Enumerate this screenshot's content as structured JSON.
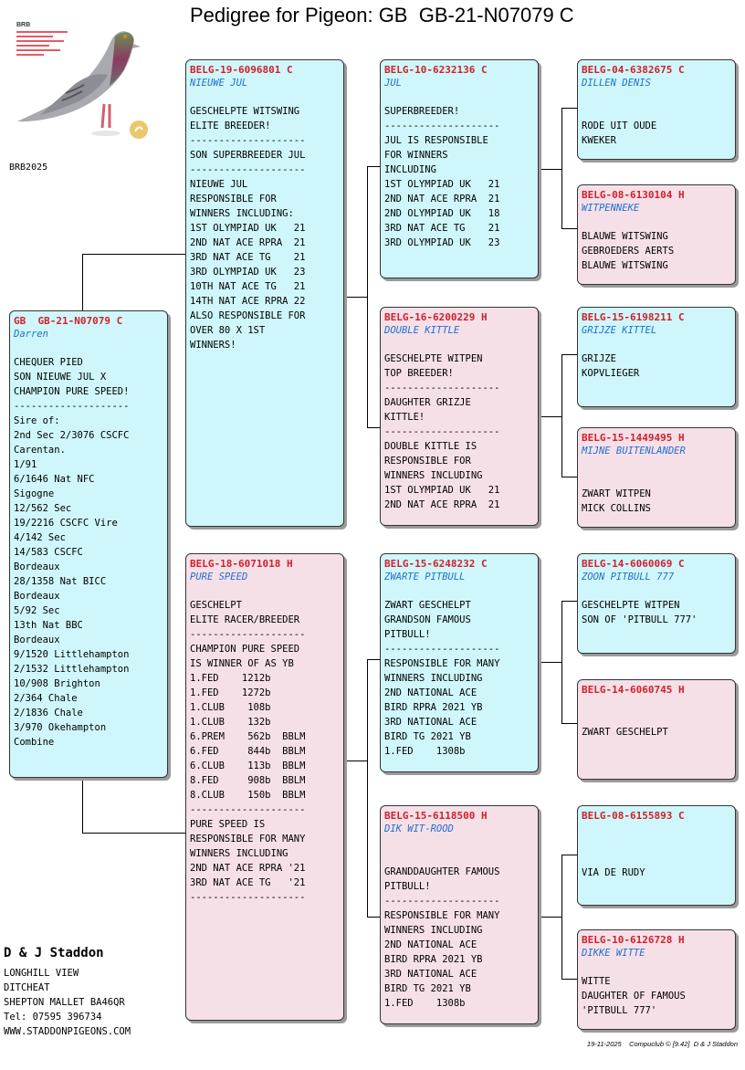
{
  "title": "Pedigree for Pigeon: GB  GB-21-N07079 C",
  "logo": {
    "brand": "BRB",
    "code": "BRB2025"
  },
  "subject": {
    "ring": "GB  GB-21-N07079 C",
    "name": "Darren",
    "details": "CHEQUER PIED\nSON NIEUWE JUL X\nCHAMPION PURE SPEED!\n--------------------\nSire of:\n2nd Sec 2/3076 CSCFC\nCarentan.\n1/91\n6/1646 Nat NFC\nSigogne\n12/562 Sec\n19/2216 CSCFC Vire\n4/142 Sec\n14/583 CSCFC\nBordeaux\n28/1358 Nat BICC\nBordeaux\n5/92 Sec\n13th Nat BBC\nBordeaux\n9/1520 Littlehampton\n2/1532 Littlehampton\n10/908 Brighton\n2/364 Chale\n2/1836 Chale\n3/970 Okehampton\nCombine"
  },
  "sire": {
    "ring": "BELG-19-6096801 C",
    "name": "NIEUWE JUL",
    "details": "GESCHELPTE WITSWING\nELITE BREEDER!\n--------------------\nSON SUPERBREEDER JUL\n--------------------\nNIEUWE JUL\nRESPONSIBLE FOR\nWINNERS INCLUDING:\n1ST OLYMPIAD UK   21\n2ND NAT ACE RPRA  21\n3RD NAT ACE TG    21\n3RD OLYMPIAD UK   23\n10TH NAT ACE TG   21\n14TH NAT ACE RPRA 22\nALSO RESPONSIBLE FOR\nOVER 80 X 1ST\nWINNERS!"
  },
  "dam": {
    "ring": "BELG-18-6071018 H",
    "name": "PURE SPEED",
    "details": "GESCHELPT\nELITE RACER/BREEDER\n--------------------\nCHAMPION PURE SPEED\nIS WINNER OF AS YB\n1.FED    1212b\n1.FED    1272b\n1.CLUB    108b\n1.CLUB    132b\n6.PREM    562b  BBLM\n6.FED     844b  BBLM\n6.CLUB    113b  BBLM\n8.FED     908b  BBLM\n8.CLUB    150b  BBLM\n--------------------\nPURE SPEED IS\nRESPONSIBLE FOR MANY\nWINNERS INCLUDING\n2ND NAT ACE RPRA '21\n3RD NAT ACE TG   '21\n--------------------"
  },
  "gen3": [
    {
      "ring": "BELG-10-6232136 C",
      "name": "JUL",
      "details": "SUPERBREEDER!\n--------------------\nJUL IS RESPONSIBLE\nFOR WINNERS\nINCLUDING\n1ST OLYMPIAD UK   21\n2ND NAT ACE RPRA  21\n2ND OLYMPIAD UK   18\n3RD NAT ACE TG    21\n3RD OLYMPIAD UK   23"
    },
    {
      "ring": "BELG-16-6200229 H",
      "name": "DOUBLE KITTLE",
      "details": "GESCHELPTE WITPEN\nTOP BREEDER!\n--------------------\nDAUGHTER GRIZJE\nKITTLE!\n--------------------\nDOUBLE KITTLE IS\nRESPONSIBLE FOR\nWINNERS INCLUDING\n1ST OLYMPIAD UK   21\n2ND NAT ACE RPRA  21"
    },
    {
      "ring": "BELG-15-6248232 C",
      "name": "ZWARTE PITBULL",
      "details": "ZWART GESCHELPT\nGRANDSON FAMOUS\nPITBULL!\n--------------------\nRESPONSIBLE FOR MANY\nWINNERS INCLUDING\n2ND NATIONAL ACE\nBIRD RPRA 2021 YB\n3RD NATIONAL ACE\nBIRD TG 2021 YB\n1.FED    1308b"
    },
    {
      "ring": "BELG-15-6118500 H",
      "name": "DIK WIT-ROOD",
      "details": "\nGRANDDAUGHTER FAMOUS\nPITBULL!\n--------------------\nRESPONSIBLE FOR MANY\nWINNERS INCLUDING\n2ND NATIONAL ACE\nBIRD RPRA 2021 YB\n3RD NATIONAL ACE\nBIRD TG 2021 YB\n1.FED    1308b"
    }
  ],
  "gen4": [
    {
      "ring": "BELG-04-6382675 C",
      "name": "DILLEN DENIS",
      "details": "\nRODE UIT OUDE\nKWEKER"
    },
    {
      "ring": "BELG-08-6130104 H",
      "name": "WITPENNEKE",
      "details": "BLAUWE WITSWING\nGEBROEDERS AERTS\nBLAUWE WITSWING"
    },
    {
      "ring": "BELG-15-6198211 C",
      "name": "GRIJZE KITTEL",
      "details": "GRIJZE\nKOPVLIEGER"
    },
    {
      "ring": "BELG-15-1449495 H",
      "name": "MIJNE BUITENLANDER",
      "details": "\nZWART WITPEN\nMICK COLLINS"
    },
    {
      "ring": "BELG-14-6060069 C",
      "name": "ZOON PITBULL 777",
      "details": "GESCHELPTE WITPEN\nSON OF 'PITBULL 777'"
    },
    {
      "ring": "BELG-14-6060745 H",
      "name": "",
      "details": "\nZWART GESCHELPT"
    },
    {
      "ring": "BELG-08-6155893 C",
      "name": "",
      "details": "\n\nVIA DE RUDY"
    },
    {
      "ring": "BELG-10-6126728 H",
      "name": "DIKKE WITTE",
      "details": "WITTE\nDAUGHTER OF FAMOUS\n'PITBULL 777'"
    }
  ],
  "breeder": {
    "name": "D & J Staddon",
    "address": "LONGHILL VIEW\nDITCHEAT\nSHEPTON MALLET BA46QR\nTel: 07595 396734\nWWW.STADDONPIGEONS.COM"
  },
  "footer": "19-11-2025    Compuclub © [9.42]  D & J Staddon",
  "colors": {
    "cock_card": "#cff7fb",
    "hen_card": "#f6e0e8",
    "ring_text": "#d0202a",
    "name_text": "#1f6fd0"
  }
}
